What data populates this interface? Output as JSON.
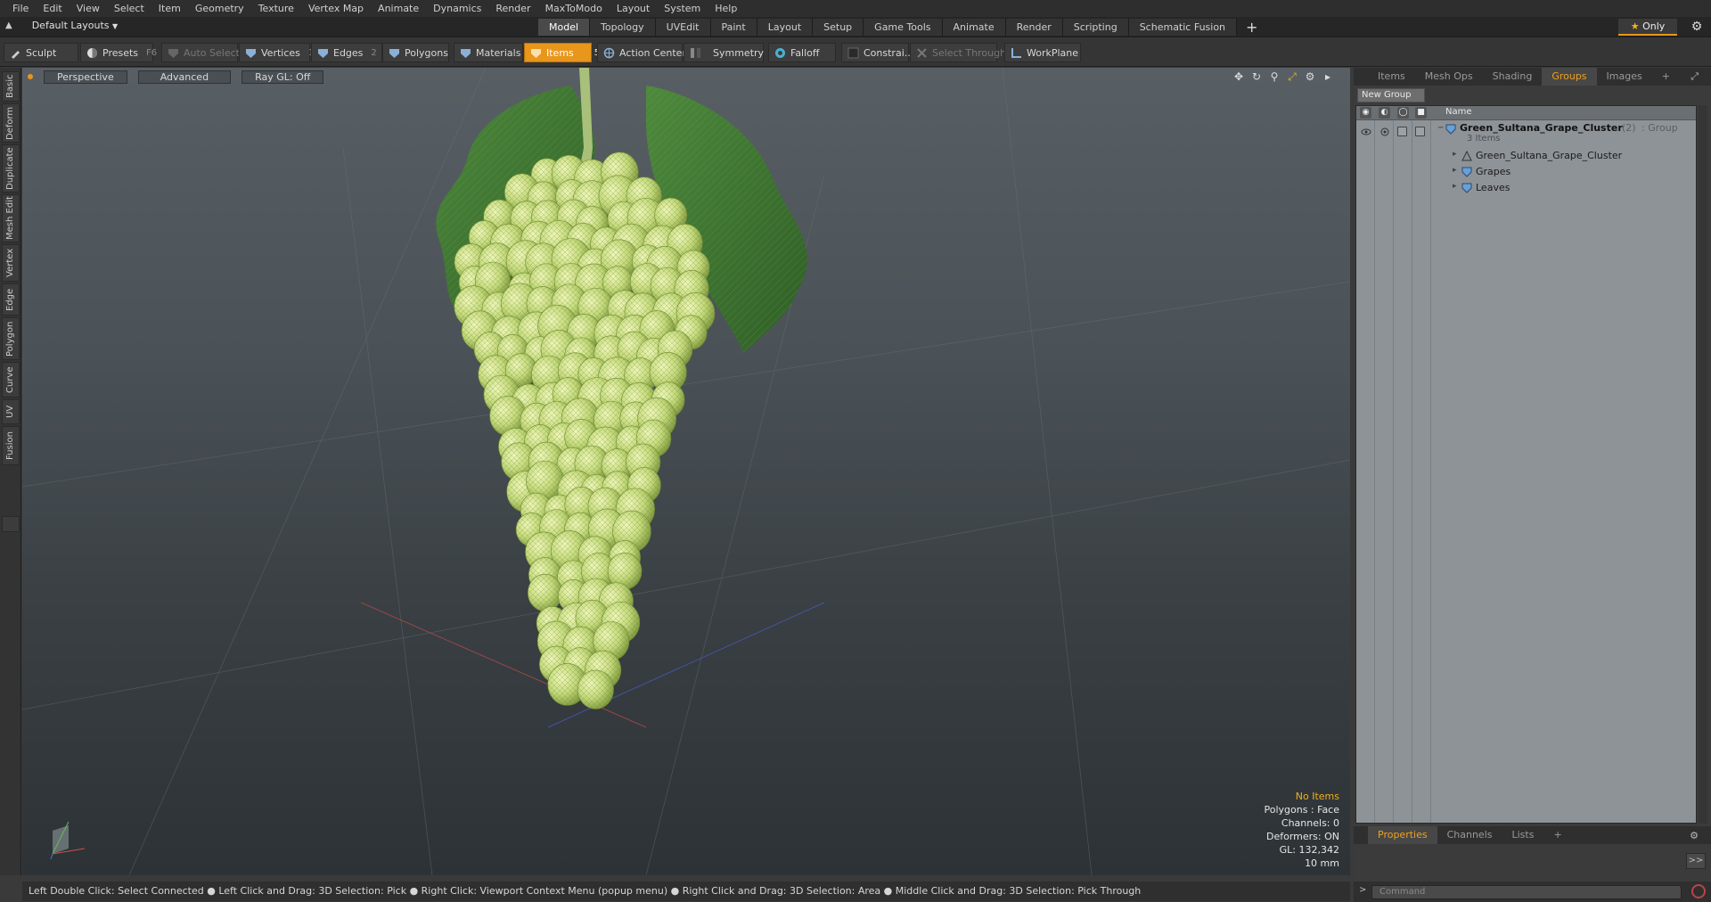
{
  "menu": [
    "File",
    "Edit",
    "View",
    "Select",
    "Item",
    "Geometry",
    "Texture",
    "Vertex Map",
    "Animate",
    "Dynamics",
    "Render",
    "MaxToModo",
    "Layout",
    "System",
    "Help"
  ],
  "layout_dropdown": "Default Layouts",
  "layout_tabs": [
    "Model",
    "Topology",
    "UVEdit",
    "Paint",
    "Layout",
    "Setup",
    "Game Tools",
    "Animate",
    "Render",
    "Scripting",
    "Schematic Fusion"
  ],
  "layout_tab_active": "Model",
  "only_label": "Only",
  "toolbar": {
    "sculpt": "Sculpt",
    "presets": "Presets",
    "presets_key": "F6",
    "auto_select": "Auto Select",
    "vertices": "Vertices",
    "vertices_key": "1",
    "edges": "Edges",
    "edges_key": "2",
    "polygons": "Polygons",
    "materials": "Materials",
    "items": "Items",
    "items_key": "5",
    "action_center": "Action Center",
    "symmetry": "Symmetry",
    "falloff": "Falloff",
    "constraints": "Constrai...",
    "select_through": "Select Through",
    "workplane": "WorkPlane"
  },
  "left_tabs": [
    "Basic",
    "Deform",
    "Duplicate",
    "Mesh Edit",
    "Vertex",
    "Edge",
    "Polygon",
    "Curve",
    "UV",
    "Fusion"
  ],
  "viewport": {
    "view_mode": "Perspective",
    "shading": "Advanced",
    "raygl": "Ray GL: Off",
    "info": {
      "selection": "No Items",
      "polygons": "Polygons : Face",
      "channels": "Channels: 0",
      "deformers": "Deformers: ON",
      "gl": "GL: 132,342",
      "scale": "10 mm"
    }
  },
  "statusbar": "Left Double Click: Select Connected ● Left Click and Drag: 3D Selection: Pick ● Right Click: Viewport Context Menu (popup menu) ● Right Click and Drag: 3D Selection: Area ● Middle Click and Drag: 3D Selection: Pick Through",
  "right_panel": {
    "tabs": [
      "Items",
      "Mesh Ops",
      "Shading",
      "Groups",
      "Images"
    ],
    "active_tab": "Groups",
    "new_group": "New Group",
    "column_name": "Name",
    "group": {
      "name": "Green_Sultana_Grape_Cluster",
      "count": "(2)",
      "type": ": Group",
      "items_count": "3 Items"
    },
    "children": [
      "Green_Sultana_Grape_Cluster",
      "Grapes",
      "Leaves"
    ],
    "bottom_tabs": [
      "Properties",
      "Channels",
      "Lists"
    ],
    "bottom_active": "Properties",
    "command_placeholder": "Command"
  },
  "colors": {
    "accent": "#e8961c",
    "grape": "#c8dc7a",
    "leaf": "#3f7a34"
  }
}
